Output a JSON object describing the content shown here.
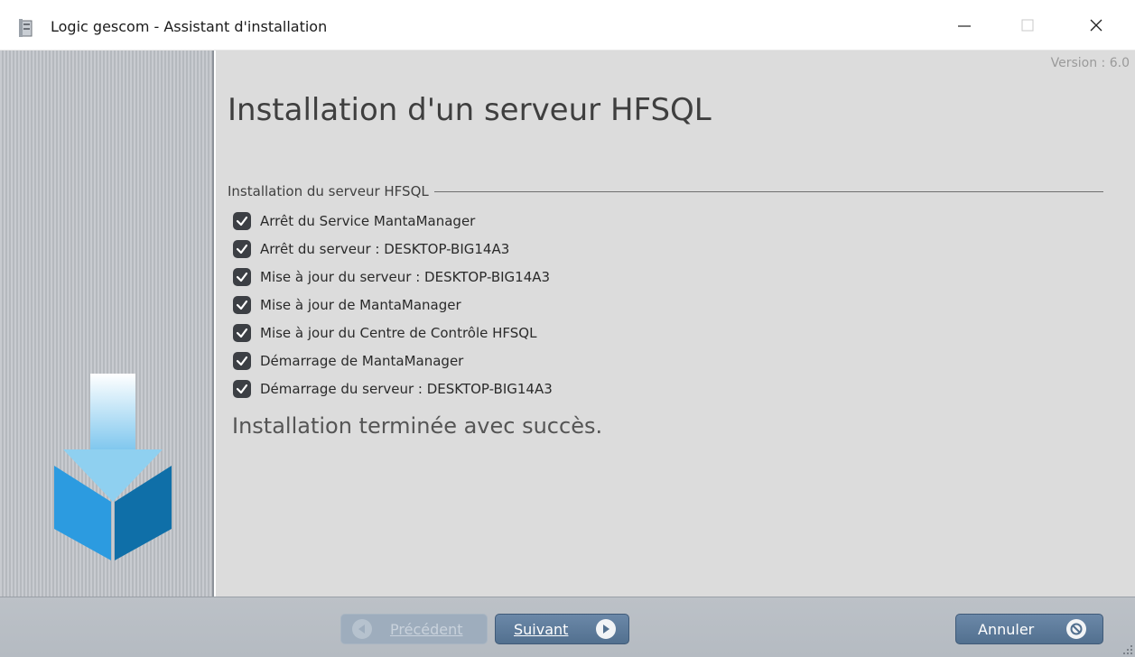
{
  "window": {
    "title": "Logic gescom - Assistant d'installation",
    "controls": [
      "minimize-icon",
      "maximize-icon",
      "close-icon"
    ]
  },
  "header": {
    "version": "Version : 6.0",
    "title": "Installation d'un serveur HFSQL"
  },
  "group": {
    "title": "Installation du serveur HFSQL",
    "steps": [
      {
        "label": "Arrêt du Service MantaManager",
        "checked": true
      },
      {
        "label": "Arrêt du serveur : DESKTOP-BIG14A3",
        "checked": true
      },
      {
        "label": "Mise à jour du serveur : DESKTOP-BIG14A3",
        "checked": true
      },
      {
        "label": "Mise à jour de MantaManager",
        "checked": true
      },
      {
        "label": "Mise à jour du Centre de Contrôle HFSQL",
        "checked": true
      },
      {
        "label": "Démarrage de MantaManager",
        "checked": true
      },
      {
        "label": "Démarrage du serveur : DESKTOP-BIG14A3",
        "checked": true
      }
    ]
  },
  "status": {
    "message": "Installation terminée avec succès."
  },
  "buttons": {
    "previous": {
      "label": "Précédent",
      "enabled": false,
      "icon": "arrow-left-icon"
    },
    "next": {
      "label": "Suivant",
      "enabled": true,
      "icon": "arrow-right-icon"
    },
    "cancel": {
      "label": "Annuler",
      "enabled": true,
      "icon": "cancel-icon"
    }
  },
  "colors": {
    "accent_button": "#5c7a9a",
    "left_arrow": "#9fd3ee",
    "left_box": "#1b8fd0"
  }
}
